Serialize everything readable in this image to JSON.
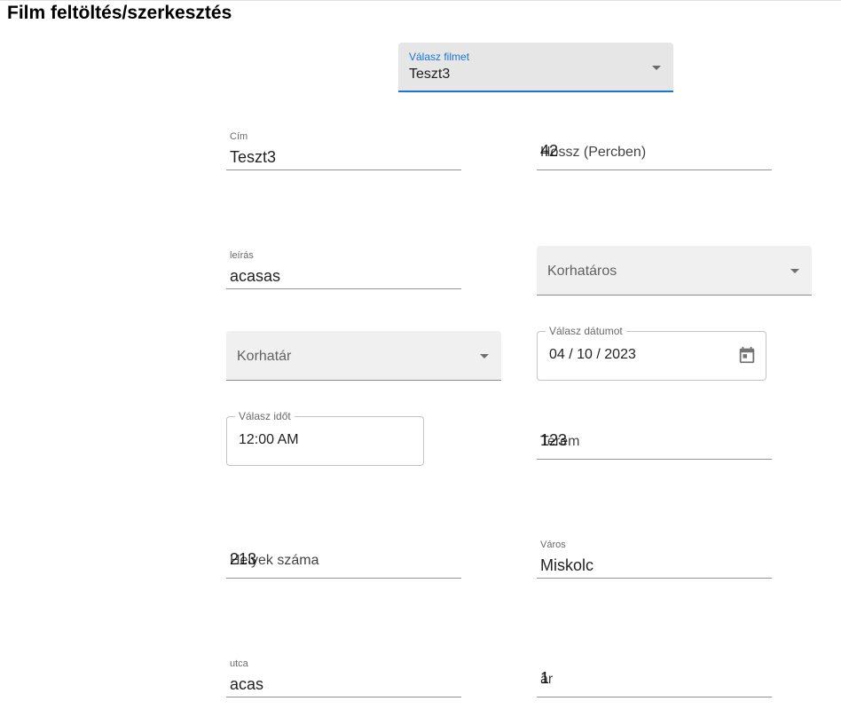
{
  "page": {
    "title": "Film feltöltés/szerkesztés"
  },
  "film_select": {
    "label": "Válasz filmet",
    "value": "Teszt3"
  },
  "fields": {
    "cim": {
      "label": "Cím",
      "value": "Teszt3"
    },
    "hossz": {
      "label": "Hossz (Percben)",
      "value": "42"
    },
    "leiras": {
      "label": "leírás",
      "value": "acasas"
    },
    "korhataros": {
      "placeholder": "Korhatáros"
    },
    "korhatar": {
      "placeholder": "Korhatár"
    },
    "datum": {
      "label": "Válasz dátumot",
      "value": "04 / 10 / 2023"
    },
    "ido": {
      "label": "Válasz időt",
      "value": "12:00 AM"
    },
    "terem": {
      "label": "Terem",
      "value": "123"
    },
    "helyek": {
      "label": "Helyek száma",
      "value": "213"
    },
    "varos": {
      "label": "Város",
      "value": "Miskolc"
    },
    "utca": {
      "label": "utca",
      "value": "acas"
    },
    "ar": {
      "label": "ár",
      "value": "1"
    }
  },
  "icons": {
    "dropdown": "arrow-drop-down-icon",
    "calendar": "calendar-icon"
  },
  "colors": {
    "accent": "#1976d2",
    "filled_bg": "#f0f0f0"
  }
}
